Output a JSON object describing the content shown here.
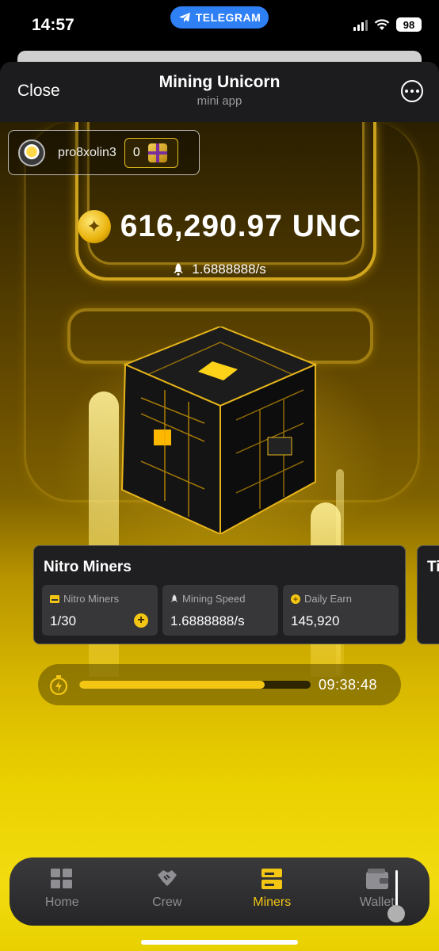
{
  "status_bar": {
    "time": "14:57",
    "telegram_label": "TELEGRAM",
    "battery": "98"
  },
  "header": {
    "close_label": "Close",
    "title": "Mining Unicorn",
    "subtitle": "mini app"
  },
  "user": {
    "username": "pro8xolin3",
    "gift_count": "0"
  },
  "balance": {
    "amount": "616,290.97 UNC",
    "rate": "1.6888888/s"
  },
  "miner_card": {
    "title": "Nitro Miners",
    "stats": [
      {
        "label": "Nitro Miners",
        "value": "1/30",
        "icon": "miner-icon"
      },
      {
        "label": "Mining Speed",
        "value": "1.6888888/s",
        "icon": "rocket-icon"
      },
      {
        "label": "Daily Earn",
        "value": "145,920",
        "icon": "coin-icon"
      }
    ],
    "next_card_title": "Ti"
  },
  "timer": {
    "value": "09:38:48",
    "progress": 0.8
  },
  "nav": {
    "items": [
      {
        "label": "Home",
        "icon": "grid-icon",
        "active": false
      },
      {
        "label": "Crew",
        "icon": "handshake-icon",
        "active": false
      },
      {
        "label": "Miners",
        "icon": "miners-icon",
        "active": true
      },
      {
        "label": "Wallet",
        "icon": "wallet-icon",
        "active": false
      }
    ]
  },
  "colors": {
    "accent": "#f3c614",
    "card_bg": "#1f1f21",
    "header_bg": "#1c1c1e",
    "telegram": "#2f7ff5"
  }
}
